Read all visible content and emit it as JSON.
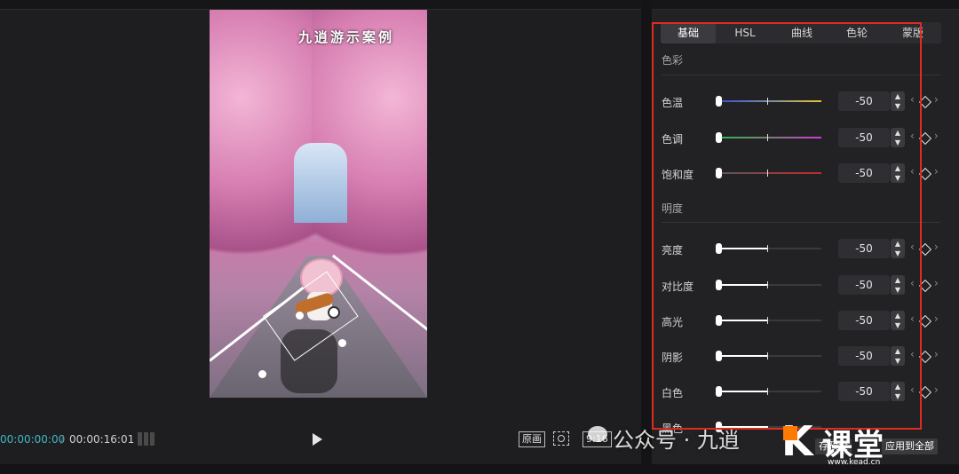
{
  "preview": {
    "overlay_title": "九逍游示案例"
  },
  "playback": {
    "current_time": "00:00:00:00",
    "separator": "/",
    "total_time": "00:00:16:01",
    "original_label": "原画",
    "ratio_label": "9:16"
  },
  "tabs": [
    {
      "label": "基础",
      "active": true
    },
    {
      "label": "HSL",
      "active": false
    },
    {
      "label": "曲线",
      "active": false
    },
    {
      "label": "色轮",
      "active": false
    },
    {
      "label": "蒙版",
      "active": false
    }
  ],
  "sections": {
    "color": "色彩",
    "brightness": "明度"
  },
  "color_rows": [
    {
      "label": "色温",
      "value": "-50",
      "level": -50
    },
    {
      "label": "色调",
      "value": "-50",
      "level": -50
    },
    {
      "label": "饱和度",
      "value": "-50",
      "level": -50
    }
  ],
  "light_rows": [
    {
      "label": "亮度",
      "value": "-50",
      "level": -50
    },
    {
      "label": "对比度",
      "value": "-50",
      "level": -50
    },
    {
      "label": "高光",
      "value": "-50",
      "level": -50
    },
    {
      "label": "阴影",
      "value": "-50",
      "level": -50
    },
    {
      "label": "白色",
      "value": "-50",
      "level": -50
    },
    {
      "label": "黑色",
      "value": "",
      "level": -50
    }
  ],
  "bottom_buttons": {
    "save_preset": "存预设",
    "apply_all": "应用到全部"
  },
  "watermark": {
    "text": "公众号 · 九逍",
    "brand": "课堂",
    "url": "www.kead.cn"
  },
  "colors": {
    "accent_cyan": "#3fb8c8",
    "highlight_red": "#e02b20",
    "brand_orange": "#ff7a00"
  }
}
